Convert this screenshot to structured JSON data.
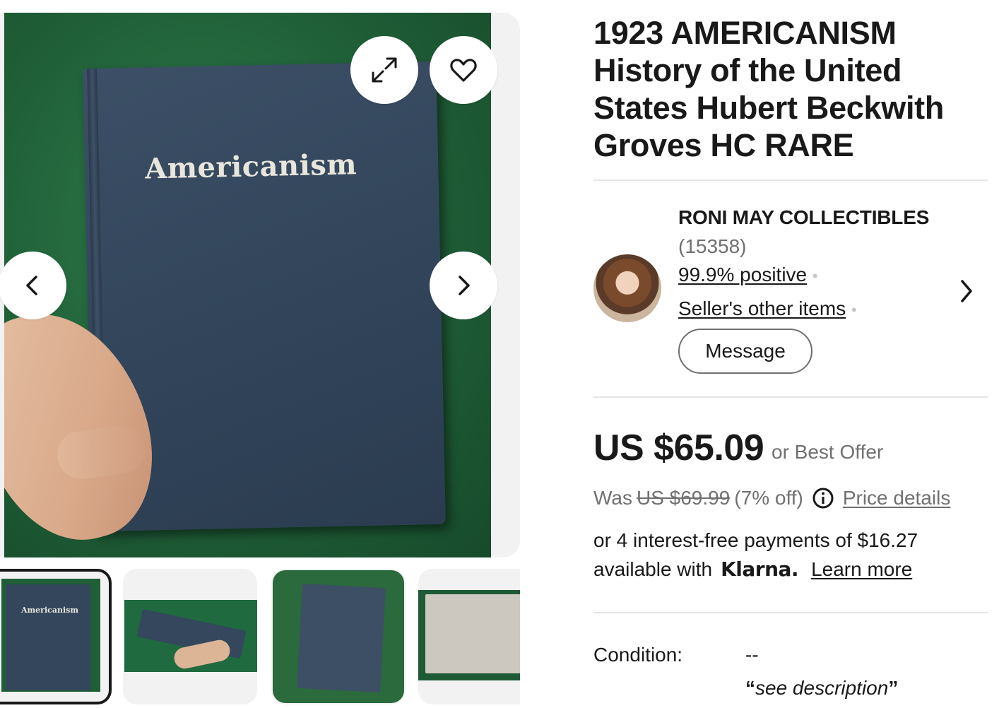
{
  "gallery": {
    "main_image_alt": "Americanism",
    "book_cover_text": "Americanism",
    "thumb_cover_text": "Americanism",
    "thumbnails_count": 4,
    "active_thumbnail": 1
  },
  "listing": {
    "title": "1923 AMERICANISM History of the United States Hubert Beckwith Groves HC RARE"
  },
  "seller": {
    "name": "RONI MAY COLLECTIBLES",
    "feedback_count": "(15358)",
    "feedback_percent": "99.9% positive",
    "other_items_label": "Seller's other items",
    "message_label": "Message"
  },
  "pricing": {
    "price": "US $65.09",
    "best_offer": "or Best Offer",
    "was_label": "Was",
    "was_price": "US $69.99",
    "discount": "(7% off)",
    "price_details_label": "Price details"
  },
  "klarna": {
    "line1": "or 4 interest-free payments of $16.27",
    "available_with": "available with",
    "brand": "Klarna.",
    "learn_more": "Learn more"
  },
  "condition": {
    "label": "Condition:",
    "value": "--",
    "note": "see description"
  },
  "colors": {
    "text": "#191919",
    "muted": "#707070",
    "divider": "#e5e5e5"
  }
}
